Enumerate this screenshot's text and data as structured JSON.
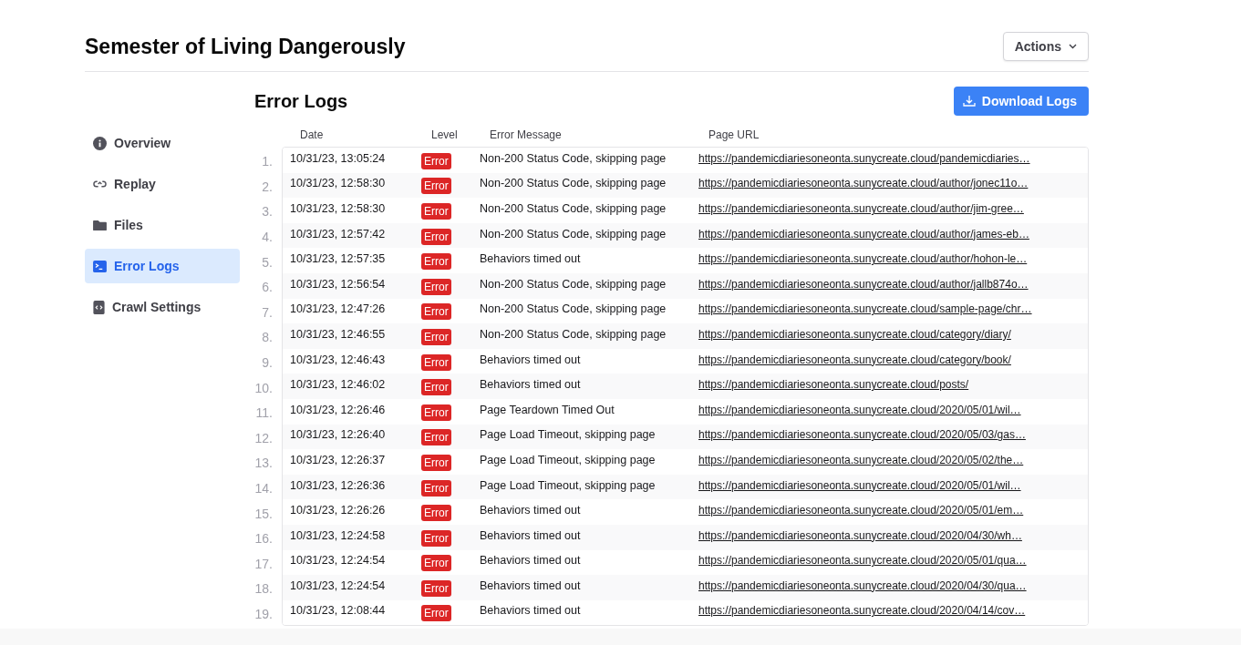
{
  "title": "Semester of Living Dangerously",
  "actions_button": "Actions",
  "sidebar": {
    "items": [
      {
        "label": "Overview",
        "kind": "info",
        "selected": false
      },
      {
        "label": "Replay",
        "kind": "replay",
        "selected": false
      },
      {
        "label": "Files",
        "kind": "folder",
        "selected": false
      },
      {
        "label": "Error Logs",
        "kind": "terminal",
        "selected": true
      },
      {
        "label": "Crawl Settings",
        "kind": "code",
        "selected": false
      }
    ]
  },
  "section_title": "Error Logs",
  "download_button": "Download Logs",
  "table": {
    "columns": [
      "Date",
      "Level",
      "Error Message",
      "Page URL"
    ],
    "rows": [
      {
        "number": "1.",
        "date": "10/31/23, 13:05:24",
        "level": "Error",
        "message": "Non-200 Status Code, skipping page",
        "url": "https://pandemicdiariesoneonta.sunycreate.cloud/pandemicdiaries…"
      },
      {
        "number": "2.",
        "date": "10/31/23, 12:58:30",
        "level": "Error",
        "message": "Non-200 Status Code, skipping page",
        "url": "https://pandemicdiariesoneonta.sunycreate.cloud/author/jonec11o…"
      },
      {
        "number": "3.",
        "date": "10/31/23, 12:58:30",
        "level": "Error",
        "message": "Non-200 Status Code, skipping page",
        "url": "https://pandemicdiariesoneonta.sunycreate.cloud/author/jim-gree…"
      },
      {
        "number": "4.",
        "date": "10/31/23, 12:57:42",
        "level": "Error",
        "message": "Non-200 Status Code, skipping page",
        "url": "https://pandemicdiariesoneonta.sunycreate.cloud/author/james-eb…"
      },
      {
        "number": "5.",
        "date": "10/31/23, 12:57:35",
        "level": "Error",
        "message": "Behaviors timed out",
        "url": "https://pandemicdiariesoneonta.sunycreate.cloud/author/hohon-le…"
      },
      {
        "number": "6.",
        "date": "10/31/23, 12:56:54",
        "level": "Error",
        "message": "Non-200 Status Code, skipping page",
        "url": "https://pandemicdiariesoneonta.sunycreate.cloud/author/jallb874o…"
      },
      {
        "number": "7.",
        "date": "10/31/23, 12:47:26",
        "level": "Error",
        "message": "Non-200 Status Code, skipping page",
        "url": "https://pandemicdiariesoneonta.sunycreate.cloud/sample-page/chr…"
      },
      {
        "number": "8.",
        "date": "10/31/23, 12:46:55",
        "level": "Error",
        "message": "Non-200 Status Code, skipping page",
        "url": "https://pandemicdiariesoneonta.sunycreate.cloud/category/diary/"
      },
      {
        "number": "9.",
        "date": "10/31/23, 12:46:43",
        "level": "Error",
        "message": "Behaviors timed out",
        "url": "https://pandemicdiariesoneonta.sunycreate.cloud/category/book/"
      },
      {
        "number": "10.",
        "date": "10/31/23, 12:46:02",
        "level": "Error",
        "message": "Behaviors timed out",
        "url": "https://pandemicdiariesoneonta.sunycreate.cloud/posts/"
      },
      {
        "number": "11.",
        "date": "10/31/23, 12:26:46",
        "level": "Error",
        "message": "Page Teardown Timed Out",
        "url": "https://pandemicdiariesoneonta.sunycreate.cloud/2020/05/01/wil…"
      },
      {
        "number": "12.",
        "date": "10/31/23, 12:26:40",
        "level": "Error",
        "message": "Page Load Timeout, skipping page",
        "url": "https://pandemicdiariesoneonta.sunycreate.cloud/2020/05/03/gas…"
      },
      {
        "number": "13.",
        "date": "10/31/23, 12:26:37",
        "level": "Error",
        "message": "Page Load Timeout, skipping page",
        "url": "https://pandemicdiariesoneonta.sunycreate.cloud/2020/05/02/the…"
      },
      {
        "number": "14.",
        "date": "10/31/23, 12:26:36",
        "level": "Error",
        "message": "Page Load Timeout, skipping page",
        "url": "https://pandemicdiariesoneonta.sunycreate.cloud/2020/05/01/wil…"
      },
      {
        "number": "15.",
        "date": "10/31/23, 12:26:26",
        "level": "Error",
        "message": "Behaviors timed out",
        "url": "https://pandemicdiariesoneonta.sunycreate.cloud/2020/05/01/em…"
      },
      {
        "number": "16.",
        "date": "10/31/23, 12:24:58",
        "level": "Error",
        "message": "Behaviors timed out",
        "url": "https://pandemicdiariesoneonta.sunycreate.cloud/2020/04/30/wh…"
      },
      {
        "number": "17.",
        "date": "10/31/23, 12:24:54",
        "level": "Error",
        "message": "Behaviors timed out",
        "url": "https://pandemicdiariesoneonta.sunycreate.cloud/2020/05/01/qua…"
      },
      {
        "number": "18.",
        "date": "10/31/23, 12:24:54",
        "level": "Error",
        "message": "Behaviors timed out",
        "url": "https://pandemicdiariesoneonta.sunycreate.cloud/2020/04/30/qua…"
      },
      {
        "number": "19.",
        "date": "10/31/23, 12:08:44",
        "level": "Error",
        "message": "Behaviors timed out",
        "url": "https://pandemicdiariesoneonta.sunycreate.cloud/2020/04/14/cov…"
      }
    ]
  }
}
